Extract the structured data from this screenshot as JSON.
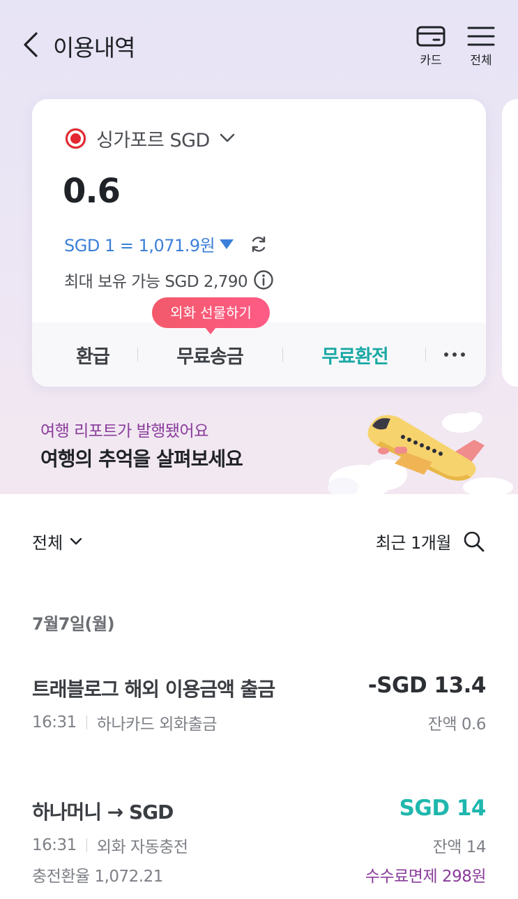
{
  "header": {
    "title": "이용내역",
    "card_label": "카드",
    "all_label": "전체"
  },
  "account": {
    "currency": "싱가포르 SGD",
    "balance": "0.6",
    "rate": "SGD 1 = 1,071.9원",
    "max_hold": "최대 보유 가능 SGD 2,790",
    "tooltip": "외화 선물하기",
    "actions": {
      "refund": "환급",
      "free_send": "무료송금",
      "free_exchange": "무료환전",
      "more": "···"
    }
  },
  "banner": {
    "subtitle": "여행 리포트가 발행됐어요",
    "title": "여행의 추억을 살펴보세요"
  },
  "filter": {
    "type": "전체",
    "period": "최근 1개월"
  },
  "date_header": "7월7일(월)",
  "transactions": [
    {
      "title": "트래블로그 해외 이용금액 출금",
      "amount": "-SGD 13.4",
      "time": "16:31",
      "desc": "하나카드 외화출금",
      "balance": "잔액 0.6"
    },
    {
      "title": "하나머니 → SGD",
      "amount": "SGD 14",
      "time": "16:31",
      "desc": "외화 자동충전",
      "balance": "잔액 14",
      "rate_line": "충전환율 1,072.21",
      "fee_line": "수수료면제 298원"
    }
  ],
  "colors": {
    "accent_teal": "#1fb7ad",
    "rate_blue": "#3c7fd8",
    "purple": "#8a3c9b",
    "tooltip_red": "#f25a6a"
  }
}
